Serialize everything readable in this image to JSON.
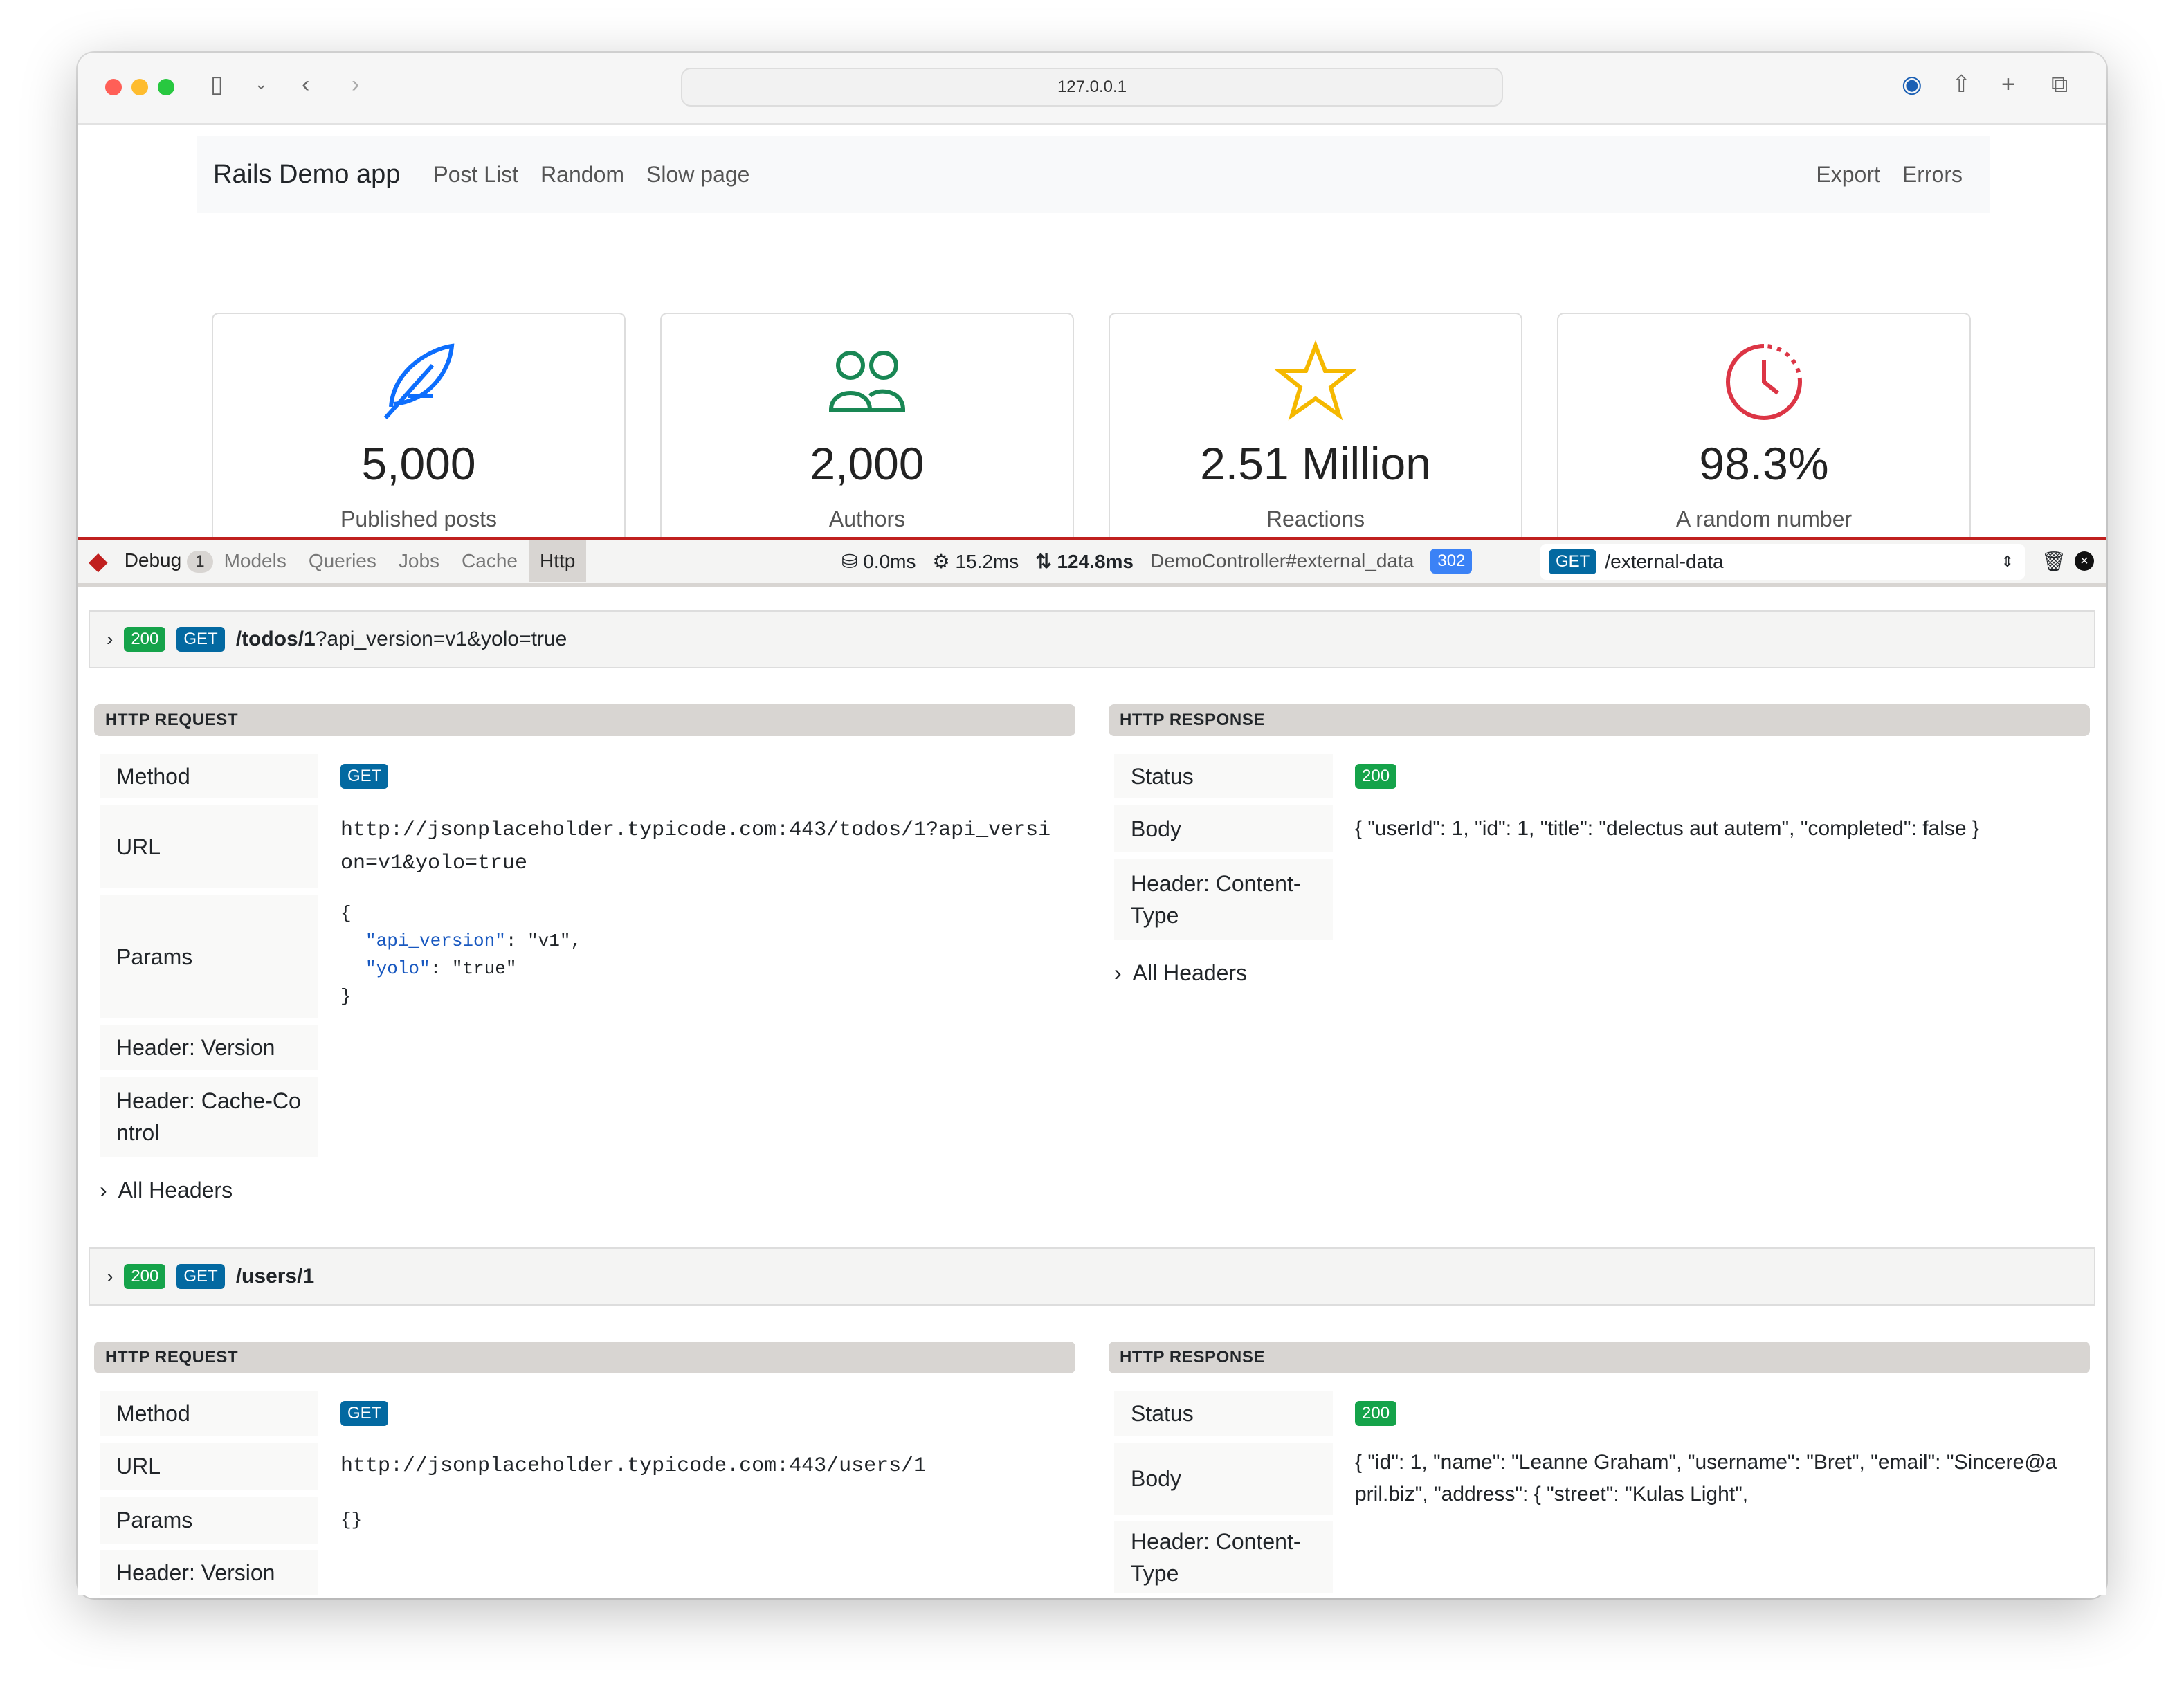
{
  "browser": {
    "address": "127.0.0.1"
  },
  "nav": {
    "brand": "Rails Demo app",
    "links": [
      "Post List",
      "Random",
      "Slow page"
    ],
    "right": [
      "Export",
      "Errors"
    ]
  },
  "stats": [
    {
      "icon": "feather-icon",
      "value": "5,000",
      "label": "Published posts",
      "color": "#0d6efd"
    },
    {
      "icon": "people-icon",
      "value": "2,000",
      "label": "Authors",
      "color": "#198754"
    },
    {
      "icon": "star-icon",
      "value": "2.51 Million",
      "label": "Reactions",
      "color": "#ffc107"
    },
    {
      "icon": "clock-icon",
      "value": "98.3%",
      "label": "A random number",
      "color": "#dc3545"
    }
  ],
  "debugbar": {
    "debug": "Debug",
    "debug_count": "1",
    "tabs": [
      "Models",
      "Queries",
      "Jobs",
      "Cache",
      "Http"
    ],
    "active_tab": "Http",
    "db_time": "0.0ms",
    "cpu_time": "15.2ms",
    "total_time": "124.8ms",
    "controller": "DemoController#external_data",
    "status": "302",
    "req_method": "GET",
    "req_path": "/external-data"
  },
  "requests": [
    {
      "status": "200",
      "method": "GET",
      "path": "/todos/1",
      "query": "?api_version=v1&yolo=true",
      "req_title": "HTTP REQUEST",
      "resp_title": "HTTP RESPONSE",
      "req": {
        "method_label": "Method",
        "url_label": "URL",
        "url": "http://jsonplaceholder.typicode.com:443/todos/1?api_version=v1&yolo=true",
        "params_label": "Params",
        "params": {
          "open": "{",
          "k1": "\"api_version\"",
          "v1": "\"v1\",",
          "k2": "\"yolo\"",
          "v2": "\"true\"",
          "close": "}"
        },
        "h1": "Header: Version",
        "h2": "Header: Cache-Control"
      },
      "resp": {
        "status_label": "Status",
        "body_label": "Body",
        "body": "{ \"userId\": 1, \"id\": 1, \"title\": \"delectus aut autem\", \"completed\": false }",
        "ct_label": "Header: Content-Type"
      },
      "all_headers": "All Headers"
    },
    {
      "status": "200",
      "method": "GET",
      "path": "/users/1",
      "req_title": "HTTP REQUEST",
      "resp_title": "HTTP RESPONSE",
      "req": {
        "method_label": "Method",
        "url_label": "URL",
        "url": "http://jsonplaceholder.typicode.com:443/users/1",
        "params_label": "Params",
        "params": "{}",
        "h1": "Header: Version"
      },
      "resp": {
        "status_label": "Status",
        "body_label": "Body",
        "body": "{ \"id\": 1, \"name\": \"Leanne Graham\", \"username\": \"Bret\", \"email\": \"Sincere@april.biz\", \"address\": { \"street\": \"Kulas Light\",",
        "ct_label": "Header: Content-Type"
      }
    }
  ]
}
